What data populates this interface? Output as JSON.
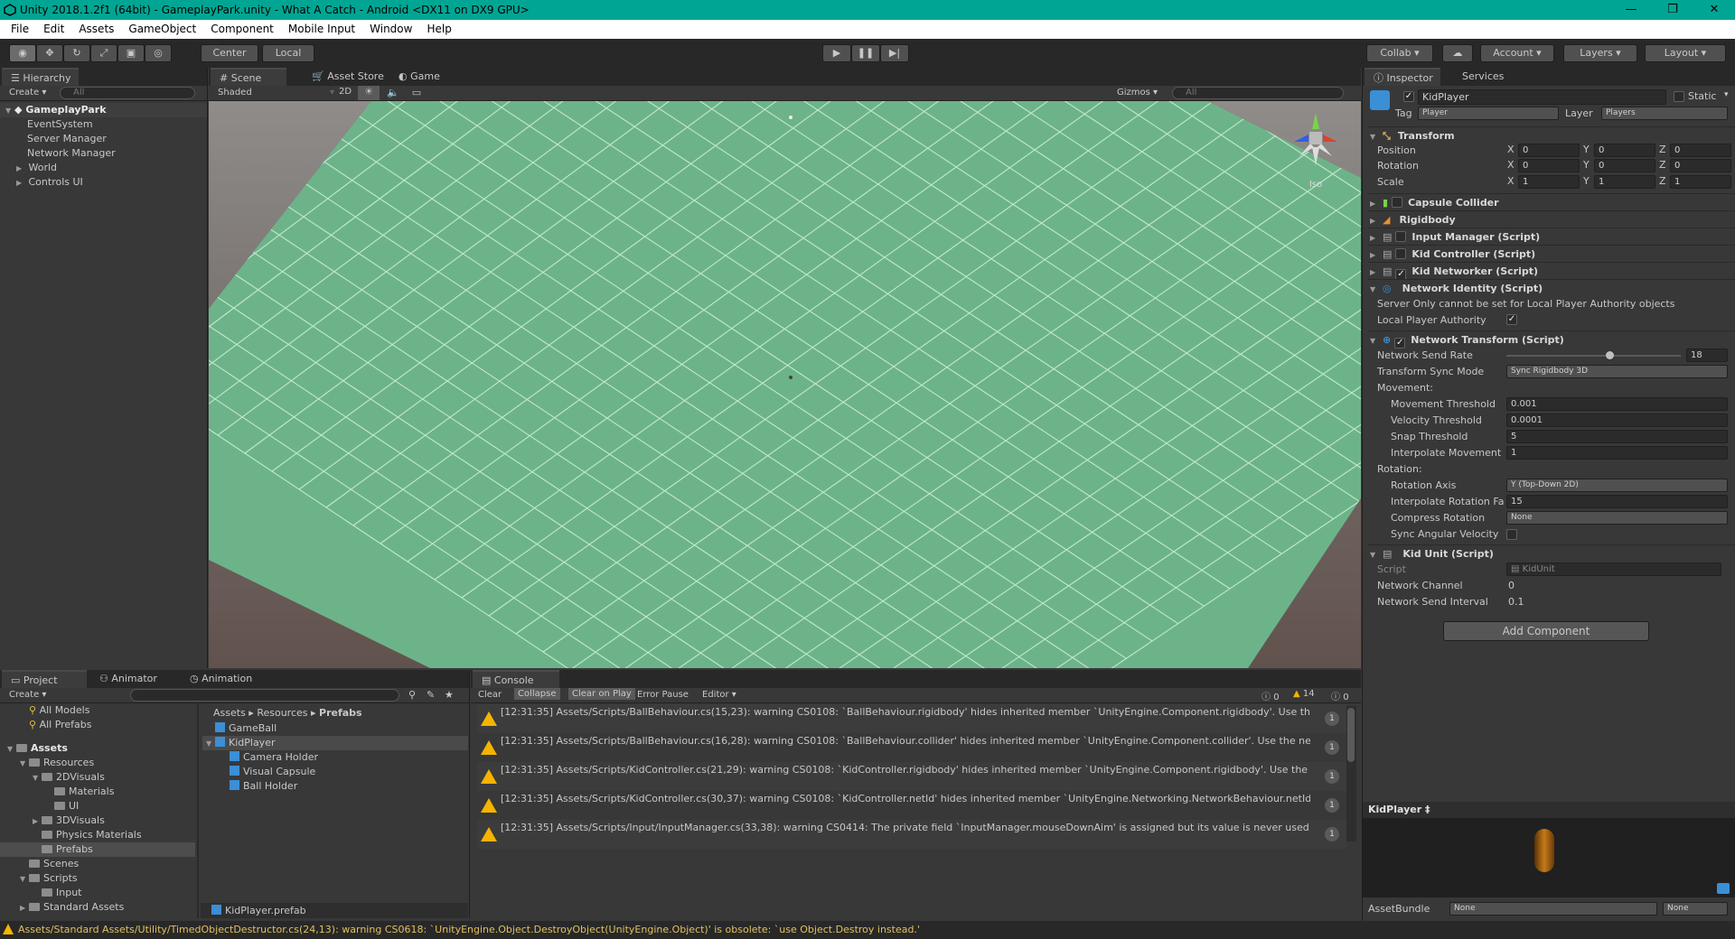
{
  "window": {
    "title": "Unity 2018.1.2f1 (64bit) - GameplayPark.unity - What A Catch - Android <DX11 on DX9 GPU>",
    "controls": [
      "—",
      "❐",
      "✕"
    ]
  },
  "menu": [
    "File",
    "Edit",
    "Assets",
    "GameObject",
    "Component",
    "Mobile Input",
    "Window",
    "Help"
  ],
  "toolbar": {
    "center": "Center",
    "local": "Local",
    "collab": "Collab ▾",
    "account": "Account",
    "layers": "Layers",
    "layout": "Layout"
  },
  "hierarchy": {
    "tab": "Hierarchy",
    "create": "Create",
    "search": "All",
    "scene": "GameplayPark",
    "items": [
      "EventSystem",
      "Server Manager",
      "Network Manager",
      "World",
      "Controls UI"
    ]
  },
  "scene": {
    "tabs": [
      "Scene",
      "Asset Store",
      "Game"
    ],
    "shading": "Shaded",
    "mode2d": "2D",
    "gizmos": "Gizmos",
    "search": "All",
    "persp": "Iso"
  },
  "inspector": {
    "tabs": [
      "Inspector",
      "Services"
    ],
    "object_name": "KidPlayer",
    "static": "Static",
    "tag_label": "Tag",
    "tag": "Player",
    "layer_label": "Layer",
    "layer": "Players",
    "transform": {
      "title": "Transform",
      "position": {
        "label": "Position",
        "x": "0",
        "y": "0",
        "z": "0"
      },
      "rotation": {
        "label": "Rotation",
        "x": "0",
        "y": "0",
        "z": "0"
      },
      "scale": {
        "label": "Scale",
        "x": "1",
        "y": "1",
        "z": "1"
      }
    },
    "components": [
      "Capsule Collider",
      "Rigidbody",
      "Input Manager (Script)",
      "Kid Controller (Script)",
      "Kid Networker (Script)"
    ],
    "network_identity": {
      "title": "Network Identity (Script)",
      "msg": "Server Only cannot be set for Local Player Authority objects",
      "lpa": "Local Player Authority"
    },
    "network_transform": {
      "title": "Network Transform (Script)",
      "send_rate_label": "Network Send Rate",
      "send_rate": "18",
      "sync_mode_label": "Transform Sync Mode",
      "sync_mode": "Sync Rigidbody 3D",
      "movement": "Movement:",
      "move_thresh_label": "Movement Threshold",
      "move_thresh": "0.001",
      "vel_thresh_label": "Velocity Threshold",
      "vel_thresh": "0.0001",
      "snap_label": "Snap Threshold",
      "snap": "5",
      "interp_move_label": "Interpolate Movement",
      "interp_move": "1",
      "rotation": "Rotation:",
      "rot_axis_label": "Rotation Axis",
      "rot_axis": "Y (Top-Down 2D)",
      "interp_rot_label": "Interpolate Rotation Fa",
      "interp_rot": "15",
      "compress_label": "Compress Rotation",
      "compress": "None",
      "sync_ang_label": "Sync Angular Velocity"
    },
    "kid_unit": {
      "title": "Kid Unit (Script)",
      "script_label": "Script",
      "script": "KidUnit",
      "channel_label": "Network Channel",
      "channel": "0",
      "interval_label": "Network Send Interval",
      "interval": "0.1"
    },
    "add_component": "Add Component",
    "preview_title": "KidPlayer ‡",
    "assetbundle_label": "AssetBundle",
    "assetbundle": "None",
    "assetvariant": "None"
  },
  "project": {
    "tabs": [
      "Project",
      "Animator",
      "Animation"
    ],
    "create": "Create",
    "favorites": [
      "All Models",
      "All Prefabs"
    ],
    "tree": [
      {
        "label": "Assets",
        "depth": 0,
        "arrow": "▼",
        "bold": true
      },
      {
        "label": "Resources",
        "depth": 1,
        "arrow": "▼"
      },
      {
        "label": "2DVisuals",
        "depth": 2,
        "arrow": "▼"
      },
      {
        "label": "Materials",
        "depth": 3,
        "arrow": ""
      },
      {
        "label": "UI",
        "depth": 3,
        "arrow": ""
      },
      {
        "label": "3DVisuals",
        "depth": 2,
        "arrow": "▶"
      },
      {
        "label": "Physics Materials",
        "depth": 2,
        "arrow": ""
      },
      {
        "label": "Prefabs",
        "depth": 2,
        "arrow": "",
        "selected": true
      },
      {
        "label": "Scenes",
        "depth": 1,
        "arrow": ""
      },
      {
        "label": "Scripts",
        "depth": 1,
        "arrow": "▼"
      },
      {
        "label": "Input",
        "depth": 2,
        "arrow": ""
      },
      {
        "label": "Standard Assets",
        "depth": 1,
        "arrow": "▶"
      }
    ],
    "breadcrumb": [
      "Assets",
      "Resources",
      "Prefabs"
    ],
    "items": [
      {
        "label": "GameBall",
        "depth": 0,
        "arrow": ""
      },
      {
        "label": "KidPlayer",
        "depth": 0,
        "arrow": "▼",
        "selected": true
      },
      {
        "label": "Camera Holder",
        "depth": 1,
        "arrow": ""
      },
      {
        "label": "Visual Capsule",
        "depth": 1,
        "arrow": ""
      },
      {
        "label": "Ball Holder",
        "depth": 1,
        "arrow": ""
      }
    ],
    "footer": "KidPlayer.prefab"
  },
  "console": {
    "tab": "Console",
    "buttons": [
      "Clear",
      "Collapse",
      "Clear on Play",
      "Error Pause",
      "Editor ▾"
    ],
    "counts": {
      "info": "0",
      "warn": "14",
      "error": "0"
    },
    "rows": [
      {
        "text": "[12:31:35] Assets/Scripts/BallBehaviour.cs(15,23): warning CS0108: `BallBehaviour.rigidbody' hides inherited member `UnityEngine.Component.rigidbody'. Use the new keyword if hiding was intended",
        "count": "1"
      },
      {
        "text": "[12:31:35] Assets/Scripts/BallBehaviour.cs(16,28): warning CS0108: `BallBehaviour.collider' hides inherited member `UnityEngine.Component.collider'. Use the new keyword if hiding was intended",
        "count": "1"
      },
      {
        "text": "[12:31:35] Assets/Scripts/KidController.cs(21,29): warning CS0108: `KidController.rigidbody' hides inherited member `UnityEngine.Component.rigidbody'. Use the new keyword if hiding was intended",
        "count": "1"
      },
      {
        "text": "[12:31:35] Assets/Scripts/KidController.cs(30,37): warning CS0108: `KidController.netId' hides inherited member `UnityEngine.Networking.NetworkBehaviour.netId'",
        "count": "1"
      },
      {
        "text": "[12:31:35] Assets/Scripts/Input/InputManager.cs(33,38): warning CS0414: The private field `InputManager.mouseDownAim' is assigned but its value is never used",
        "count": "1"
      }
    ]
  },
  "statusbar": "Assets/Standard Assets/Utility/TimedObjectDestructor.cs(24,13): warning CS0618: `UnityEngine.Object.DestroyObject(UnityEngine.Object)' is obsolete: `use Object.Destroy instead.'",
  "colors": {
    "titlebar": "#00a693",
    "ground": "#6db38a",
    "grid": "#c9f0d2",
    "background": "#6d5e5a",
    "warning": "#f5b400",
    "selection": "#4a6b93"
  }
}
